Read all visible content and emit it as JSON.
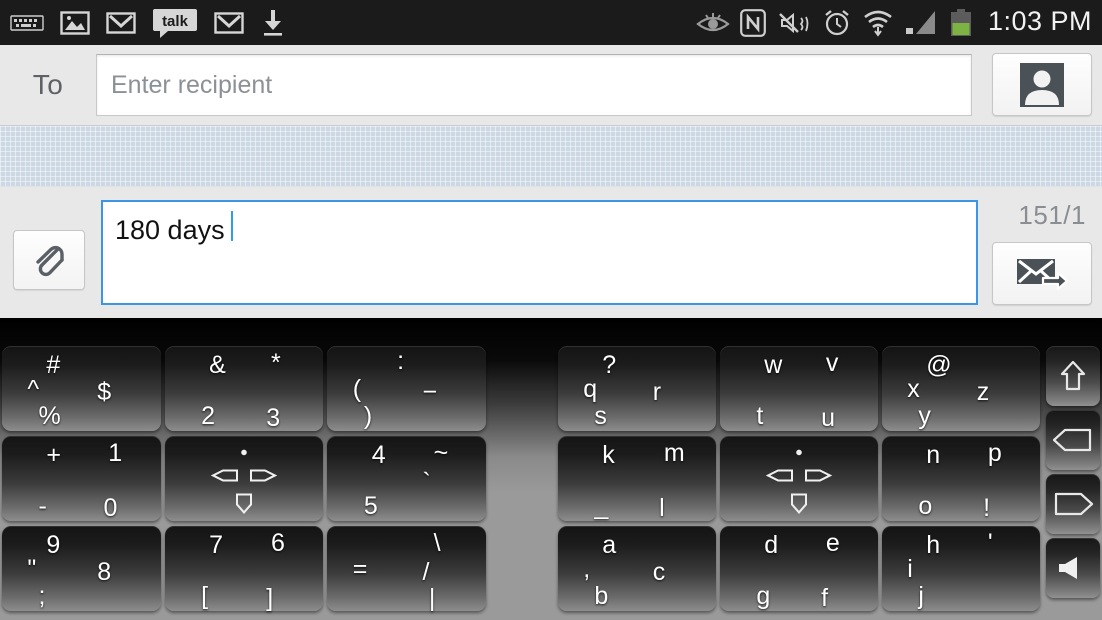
{
  "statusbar": {
    "left_icons": [
      "keyboard-icon",
      "photo-icon",
      "gmail-icon",
      "talk-icon",
      "gmail-icon-2",
      "download-icon"
    ],
    "right_icons": [
      "smart-stay-eye-icon",
      "nfc-icon",
      "mute-vibrate-icon",
      "alarm-clock-icon",
      "wifi-icon",
      "signal-bars-icon",
      "battery-icon"
    ],
    "talk_label": "talk",
    "clock": "1:03 PM"
  },
  "compose": {
    "to_label": "To",
    "recipient_placeholder": "Enter recipient",
    "recipient_value": "",
    "contact_button_icon": "contact-person-icon",
    "attach_button_icon": "paperclip-icon",
    "message_text": "180 days",
    "counter": "151/1",
    "send_button_icon": "send-envelope-icon"
  },
  "keyboard": {
    "type": "split-thumb-keyboard",
    "left": [
      [
        {
          "name": "key-symbols-1",
          "glyphs": [
            {
              "ch": "^",
              "pos": "p-ml"
            },
            {
              "ch": "#",
              "pos": "p-tl"
            },
            {
              "ch": "$",
              "pos": "p-mr"
            },
            {
              "ch": "%",
              "pos": "p-bl"
            }
          ]
        },
        {
          "name": "key-2-3",
          "glyphs": [
            {
              "ch": "&",
              "pos": "p-tl"
            },
            {
              "ch": "*",
              "pos": "p-tr"
            },
            {
              "ch": "2",
              "pos": "p-bl"
            },
            {
              "ch": "3",
              "pos": "p-br"
            }
          ]
        },
        {
          "name": "key-parens",
          "glyphs": [
            {
              "ch": ":",
              "pos": "p-tc"
            },
            {
              "ch": "(",
              "pos": "p-ml"
            },
            {
              "ch": "−",
              "pos": "p-mr"
            },
            {
              "ch": ")",
              "pos": "p-bl"
            }
          ]
        }
      ],
      [
        {
          "name": "key-1-0",
          "glyphs": [
            {
              "ch": "+",
              "pos": "p-tl"
            },
            {
              "ch": "1",
              "pos": "p-tr"
            },
            {
              "ch": "-",
              "pos": "p-bl"
            },
            {
              "ch": "0",
              "pos": "p-br"
            }
          ]
        },
        {
          "name": "key-arrows-left",
          "glyphs": [],
          "icon": "arrow-cluster-icon"
        },
        {
          "name": "key-4-5",
          "glyphs": [
            {
              "ch": "4",
              "pos": "p-tl"
            },
            {
              "ch": "~",
              "pos": "p-tr"
            },
            {
              "ch": "5",
              "pos": "p-bl"
            },
            {
              "ch": "`",
              "pos": "p-mr"
            }
          ]
        }
      ],
      [
        {
          "name": "key-9-8",
          "glyphs": [
            {
              "ch": "\"",
              "pos": "p-ml"
            },
            {
              "ch": "9",
              "pos": "p-tl"
            },
            {
              "ch": "8",
              "pos": "p-mr"
            },
            {
              "ch": ";",
              "pos": "p-bl"
            }
          ]
        },
        {
          "name": "key-7-6",
          "glyphs": [
            {
              "ch": "7",
              "pos": "p-tl"
            },
            {
              "ch": "6",
              "pos": "p-tr"
            },
            {
              "ch": "[",
              "pos": "p-bl"
            },
            {
              "ch": "]",
              "pos": "p-br"
            }
          ]
        },
        {
          "name": "key-slash",
          "glyphs": [
            {
              "ch": "=",
              "pos": "p-ml"
            },
            {
              "ch": "\\",
              "pos": "p-tr"
            },
            {
              "ch": "/",
              "pos": "p-mr"
            },
            {
              "ch": "|",
              "pos": "p-br"
            }
          ]
        }
      ]
    ],
    "right": [
      [
        {
          "name": "key-qrs",
          "glyphs": [
            {
              "ch": "?",
              "pos": "p-tl"
            },
            {
              "ch": "q",
              "pos": "p-ml"
            },
            {
              "ch": "r",
              "pos": "p-mr"
            },
            {
              "ch": "s",
              "pos": "p-bl"
            }
          ]
        },
        {
          "name": "key-wvtu",
          "glyphs": [
            {
              "ch": "w",
              "pos": "p-tl"
            },
            {
              "ch": "v",
              "pos": "p-tr"
            },
            {
              "ch": "t",
              "pos": "p-bl"
            },
            {
              "ch": "u",
              "pos": "p-br"
            }
          ]
        },
        {
          "name": "key-xzy",
          "glyphs": [
            {
              "ch": "@",
              "pos": "p-tl"
            },
            {
              "ch": "x",
              "pos": "p-ml"
            },
            {
              "ch": "z",
              "pos": "p-mr"
            },
            {
              "ch": "y",
              "pos": "p-bl"
            }
          ]
        }
      ],
      [
        {
          "name": "key-kml",
          "glyphs": [
            {
              "ch": "k",
              "pos": "p-tl"
            },
            {
              "ch": "m",
              "pos": "p-tr"
            },
            {
              "ch": "_",
              "pos": "p-bl"
            },
            {
              "ch": "l",
              "pos": "p-br"
            }
          ]
        },
        {
          "name": "key-arrows-right",
          "glyphs": [],
          "icon": "arrow-cluster-icon"
        },
        {
          "name": "key-npo",
          "glyphs": [
            {
              "ch": "n",
              "pos": "p-tl"
            },
            {
              "ch": "p",
              "pos": "p-tr"
            },
            {
              "ch": "o",
              "pos": "p-bl"
            },
            {
              "ch": "!",
              "pos": "p-br"
            }
          ]
        }
      ],
      [
        {
          "name": "key-acb",
          "glyphs": [
            {
              "ch": "a",
              "pos": "p-tl"
            },
            {
              "ch": ",",
              "pos": "p-ml"
            },
            {
              "ch": "c",
              "pos": "p-mr"
            },
            {
              "ch": "b",
              "pos": "p-bl"
            }
          ]
        },
        {
          "name": "key-degf",
          "glyphs": [
            {
              "ch": "d",
              "pos": "p-tl"
            },
            {
              "ch": "e",
              "pos": "p-tr"
            },
            {
              "ch": "g",
              "pos": "p-bl"
            },
            {
              "ch": "f",
              "pos": "p-br"
            }
          ]
        },
        {
          "name": "key-hij",
          "glyphs": [
            {
              "ch": "h",
              "pos": "p-tl"
            },
            {
              "ch": "'",
              "pos": "p-tr"
            },
            {
              "ch": "i",
              "pos": "p-ml"
            },
            {
              "ch": "j",
              "pos": "p-bl"
            }
          ]
        }
      ]
    ],
    "function_keys": [
      "shift-key-icon",
      "backspace-key-icon",
      "enter-key-icon",
      "speaker-key-icon"
    ]
  },
  "colors": {
    "accent_blue": "#3b97e3",
    "strip_blue": "#ccd8e4",
    "panel_gray": "#e8e8e8",
    "statusbar_black": "#1b1b1b",
    "battery_green": "#7cb342"
  }
}
